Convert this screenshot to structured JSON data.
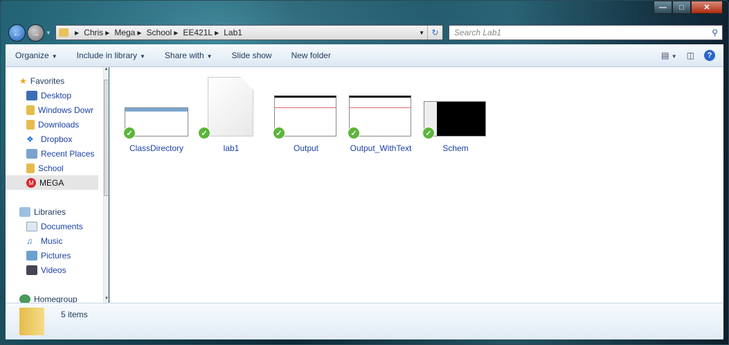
{
  "window": {
    "minimize": "—",
    "maximize": "□",
    "close": "✕"
  },
  "address": {
    "crumbs": [
      "Chris",
      "Mega",
      "School",
      "EE421L",
      "Lab1"
    ]
  },
  "search": {
    "placeholder": "Search Lab1"
  },
  "toolbar": {
    "items": [
      "Organize",
      "Include in library",
      "Share with",
      "Slide show",
      "New folder"
    ]
  },
  "nav": {
    "favorites": {
      "label": "Favorites",
      "items": [
        "Desktop",
        "Windows Dowr",
        "Downloads",
        "Dropbox",
        "Recent Places",
        "School",
        "MEGA"
      ]
    },
    "libraries": {
      "label": "Libraries",
      "items": [
        "Documents",
        "Music",
        "Pictures",
        "Videos"
      ]
    },
    "homegroup": "Homegroup"
  },
  "files": [
    {
      "name": "ClassDirectory",
      "type": "image",
      "synced": true
    },
    {
      "name": "lab1",
      "type": "document",
      "synced": true
    },
    {
      "name": "Output",
      "type": "image",
      "synced": true
    },
    {
      "name": "Output_WithText",
      "type": "image",
      "synced": true
    },
    {
      "name": "Schem",
      "type": "image",
      "synced": true
    }
  ],
  "status": {
    "count": "5 items"
  },
  "colors": {
    "link": "#1a3fa5",
    "sync": "#5bb53b",
    "toolbar_text": "#1e395b"
  }
}
